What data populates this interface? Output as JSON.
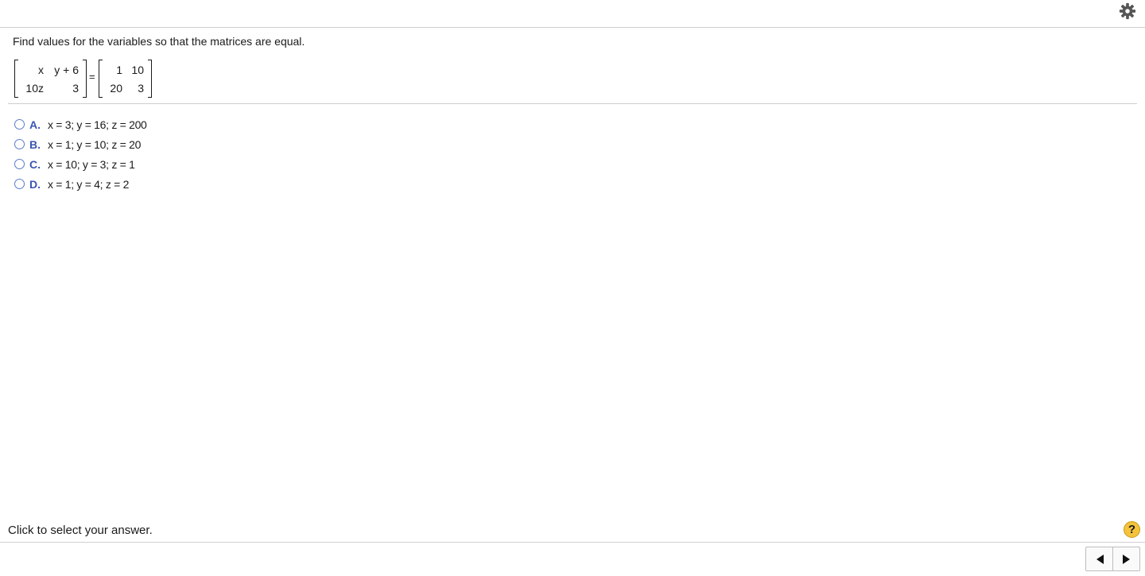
{
  "toolbar": {
    "settings_icon": "gear-icon"
  },
  "question": {
    "prompt": "Find values for the variables so that the matrices are equal.",
    "left_matrix": {
      "r1c1": "x",
      "r1c2": "y + 6",
      "r2c1": "10z",
      "r2c2": "3"
    },
    "equals": "=",
    "right_matrix": {
      "r1c1": "1",
      "r1c2": "10",
      "r2c1": "20",
      "r2c2": "3"
    }
  },
  "options": [
    {
      "letter": "A.",
      "text": "x = 3; y = 16; z = 200"
    },
    {
      "letter": "B.",
      "text": "x = 1; y = 10; z = 20"
    },
    {
      "letter": "C.",
      "text": "x = 10; y = 3; z = 1"
    },
    {
      "letter": "D.",
      "text": "x = 1; y = 4; z = 2"
    }
  ],
  "footer": {
    "status": "Click to select your answer.",
    "help_label": "?",
    "help_icon": "help-icon",
    "prev_icon": "arrow-left-icon",
    "next_icon": "arrow-right-icon"
  },
  "colors": {
    "option_letter": "#3b55b4",
    "radio_border": "#5b7cc8",
    "help_button": "#f5c33b"
  }
}
